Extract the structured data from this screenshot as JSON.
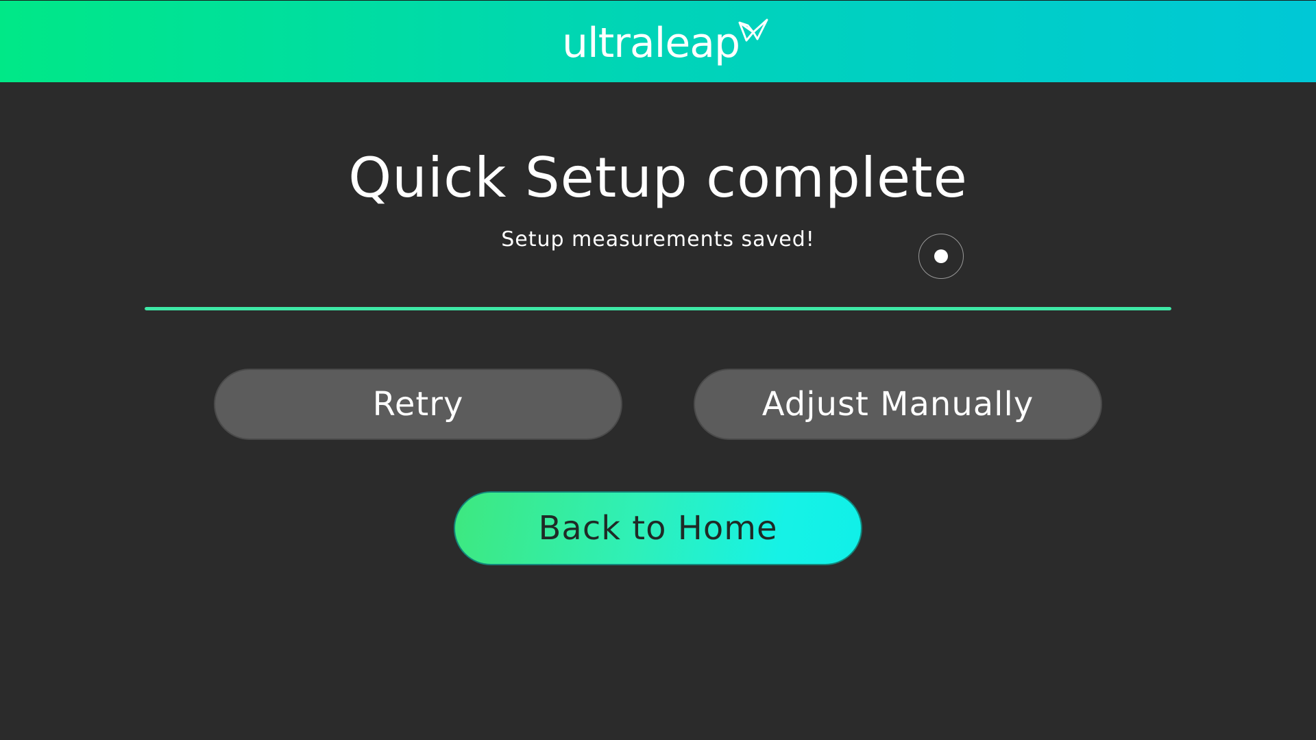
{
  "header": {
    "logo_text": "ultraleap",
    "logo_icon": "ultraleap-bird-logo",
    "gradient_colors": [
      "#00e887",
      "#00c8d6"
    ]
  },
  "main": {
    "title": "Quick Setup complete",
    "subtitle": "Setup measurements saved!",
    "progress": 1.0,
    "progress_color": "#3ee8a6"
  },
  "buttons": {
    "retry_label": "Retry",
    "adjust_label": "Adjust Manually",
    "home_label": "Back to Home"
  },
  "cursor": {
    "icon": "hand-cursor-icon"
  }
}
